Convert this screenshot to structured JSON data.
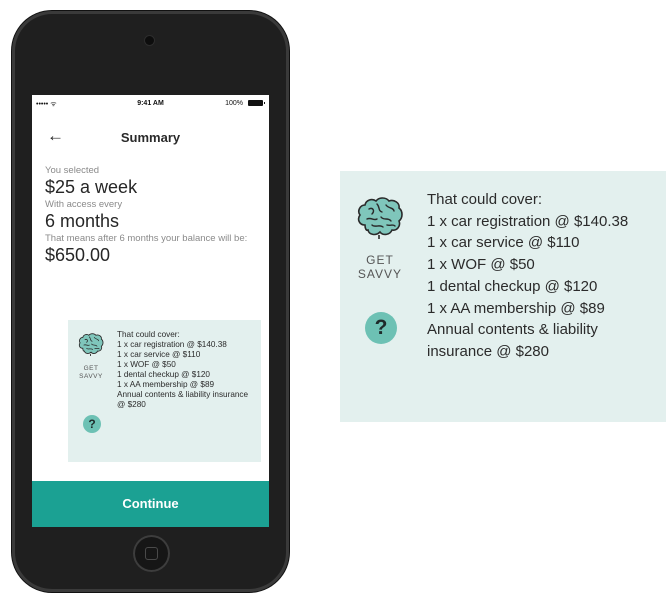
{
  "status_bar": {
    "signal": "••••• ᯤ",
    "time": "9:41 AM",
    "battery": "100%"
  },
  "nav": {
    "back": "←",
    "title": "Summary"
  },
  "summary": {
    "selected_label": "You selected",
    "selected_value": "$25 a week",
    "access_label": "With access every",
    "access_value": "6 months",
    "balance_label": "That means after 6 months your balance will be:",
    "balance_value": "$650.00"
  },
  "savvy": {
    "get_label": "GET",
    "savvy_label": "SAVVY",
    "help_icon_glyph": "?",
    "heading": "That could cover:",
    "items": [
      "1 x car registration @ $140.38",
      "1 x car service @ $110",
      "1 x WOF @ $50",
      "1 dental checkup @ $120",
      "1 x AA membership @ $89",
      "Annual contents & liability insurance @ $280"
    ]
  },
  "continue_label": "Continue",
  "colors": {
    "accent": "#1ba193",
    "card_bg": "#e3f0ee",
    "help_bg": "#6dc1b4",
    "phone_body": "#1f1f1f"
  },
  "icons": [
    "brain-icon",
    "question-icon",
    "back-arrow-icon",
    "battery-icon",
    "wifi-icon"
  ]
}
